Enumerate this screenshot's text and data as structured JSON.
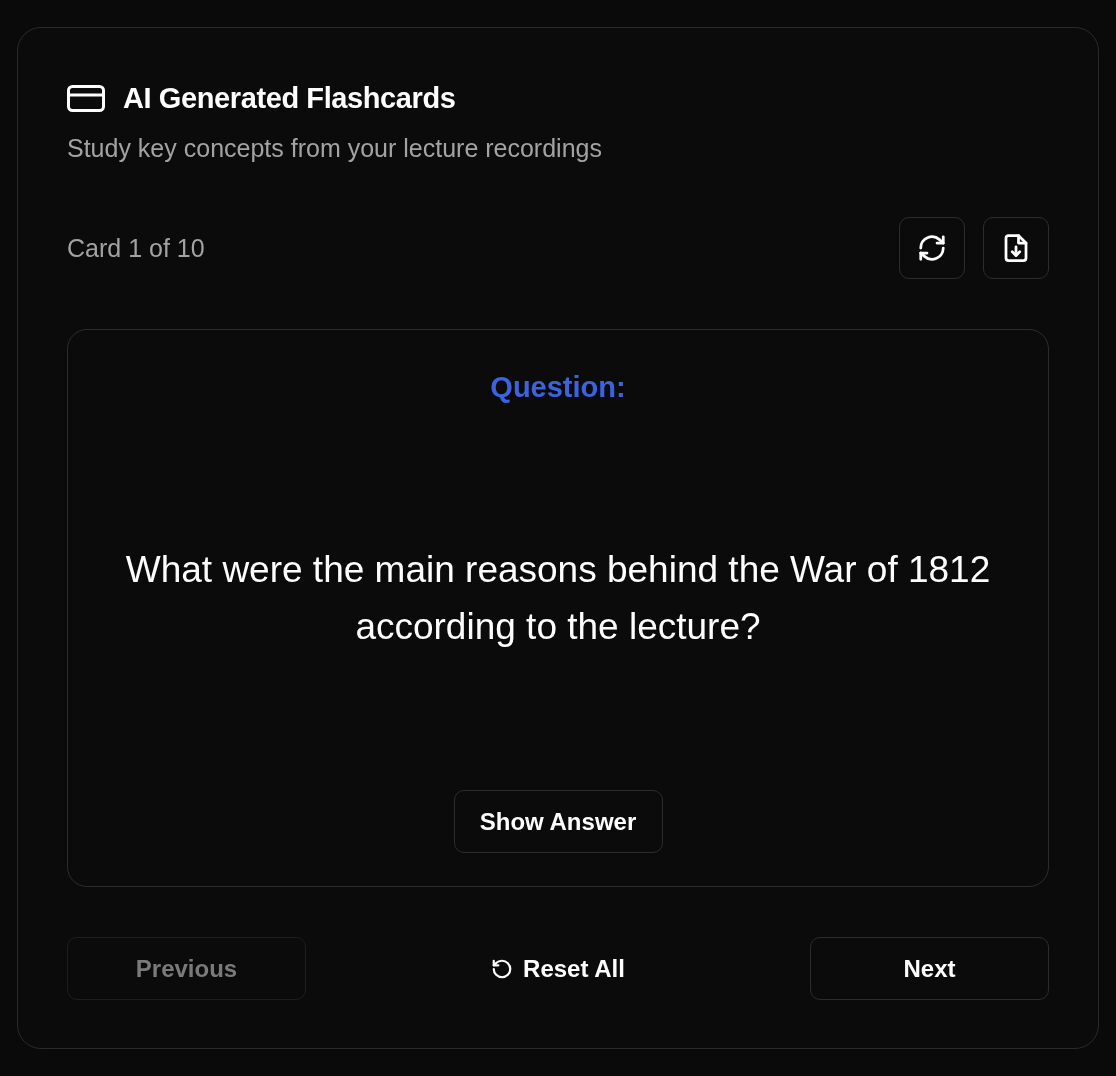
{
  "header": {
    "title": "AI Generated Flashcards",
    "subtitle": "Study key concepts from your lecture recordings"
  },
  "progress": {
    "label": "Card 1 of 10"
  },
  "flashcard": {
    "side_label": "Question:",
    "text": "What were the main reasons behind the War of 1812 according to the lecture?",
    "flip_button": "Show Answer"
  },
  "navigation": {
    "previous": {
      "label": "Previous",
      "disabled": true
    },
    "reset": {
      "label": "Reset All"
    },
    "next": {
      "label": "Next",
      "disabled": false
    }
  }
}
